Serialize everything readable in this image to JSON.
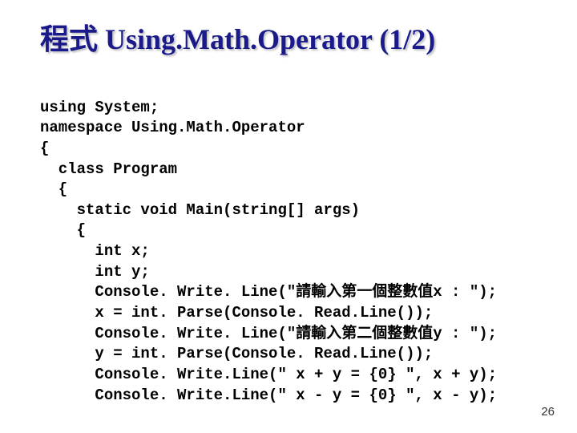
{
  "title": "程式 Using.Math.Operator (1/2)",
  "code": {
    "l1": "using System;",
    "l2": "namespace Using.Math.Operator",
    "l3": "{",
    "l4": "  class Program",
    "l5": "  {",
    "l6": "    static void Main(string[] args)",
    "l7": "    {",
    "l8": "      int x;",
    "l9": "      int y;",
    "l10": "      Console. Write. Line(\"請輸入第一個整數值x : \");",
    "l11": "      x = int. Parse(Console. Read.Line());",
    "l12": "      Console. Write. Line(\"請輸入第二個整數值y : \");",
    "l13": "      y = int. Parse(Console. Read.Line());",
    "l14": "      Console. Write.Line(\" x + y = {0} \", x + y);",
    "l15": "      Console. Write.Line(\" x - y = {0} \", x - y);"
  },
  "page_number": "26"
}
